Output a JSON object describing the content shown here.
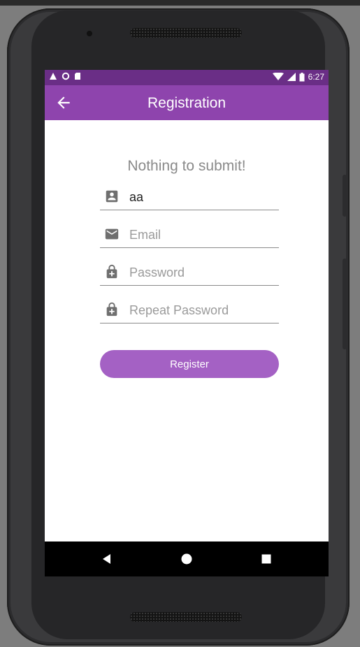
{
  "status_bar": {
    "time": "6:27",
    "left_icons": [
      "warning-icon",
      "circle-icon",
      "sd-card-icon"
    ],
    "right_icons": [
      "wifi-icon",
      "signal-icon",
      "battery-icon"
    ]
  },
  "app_bar": {
    "title": "Registration",
    "back_icon": "arrow-back-icon",
    "color": "#8e44ad"
  },
  "form": {
    "message": "Nothing to submit!",
    "fields": [
      {
        "icon": "person-icon",
        "value": "aa",
        "placeholder": ""
      },
      {
        "icon": "mail-icon",
        "value": "",
        "placeholder": "Email"
      },
      {
        "icon": "lock-icon",
        "value": "",
        "placeholder": "Password"
      },
      {
        "icon": "lock-icon",
        "value": "",
        "placeholder": "Repeat Password"
      }
    ],
    "submit_label": "Register",
    "button_color": "#a461c4"
  },
  "nav_bar": {
    "buttons": [
      "back-triangle-icon",
      "home-circle-icon",
      "recents-square-icon"
    ]
  }
}
